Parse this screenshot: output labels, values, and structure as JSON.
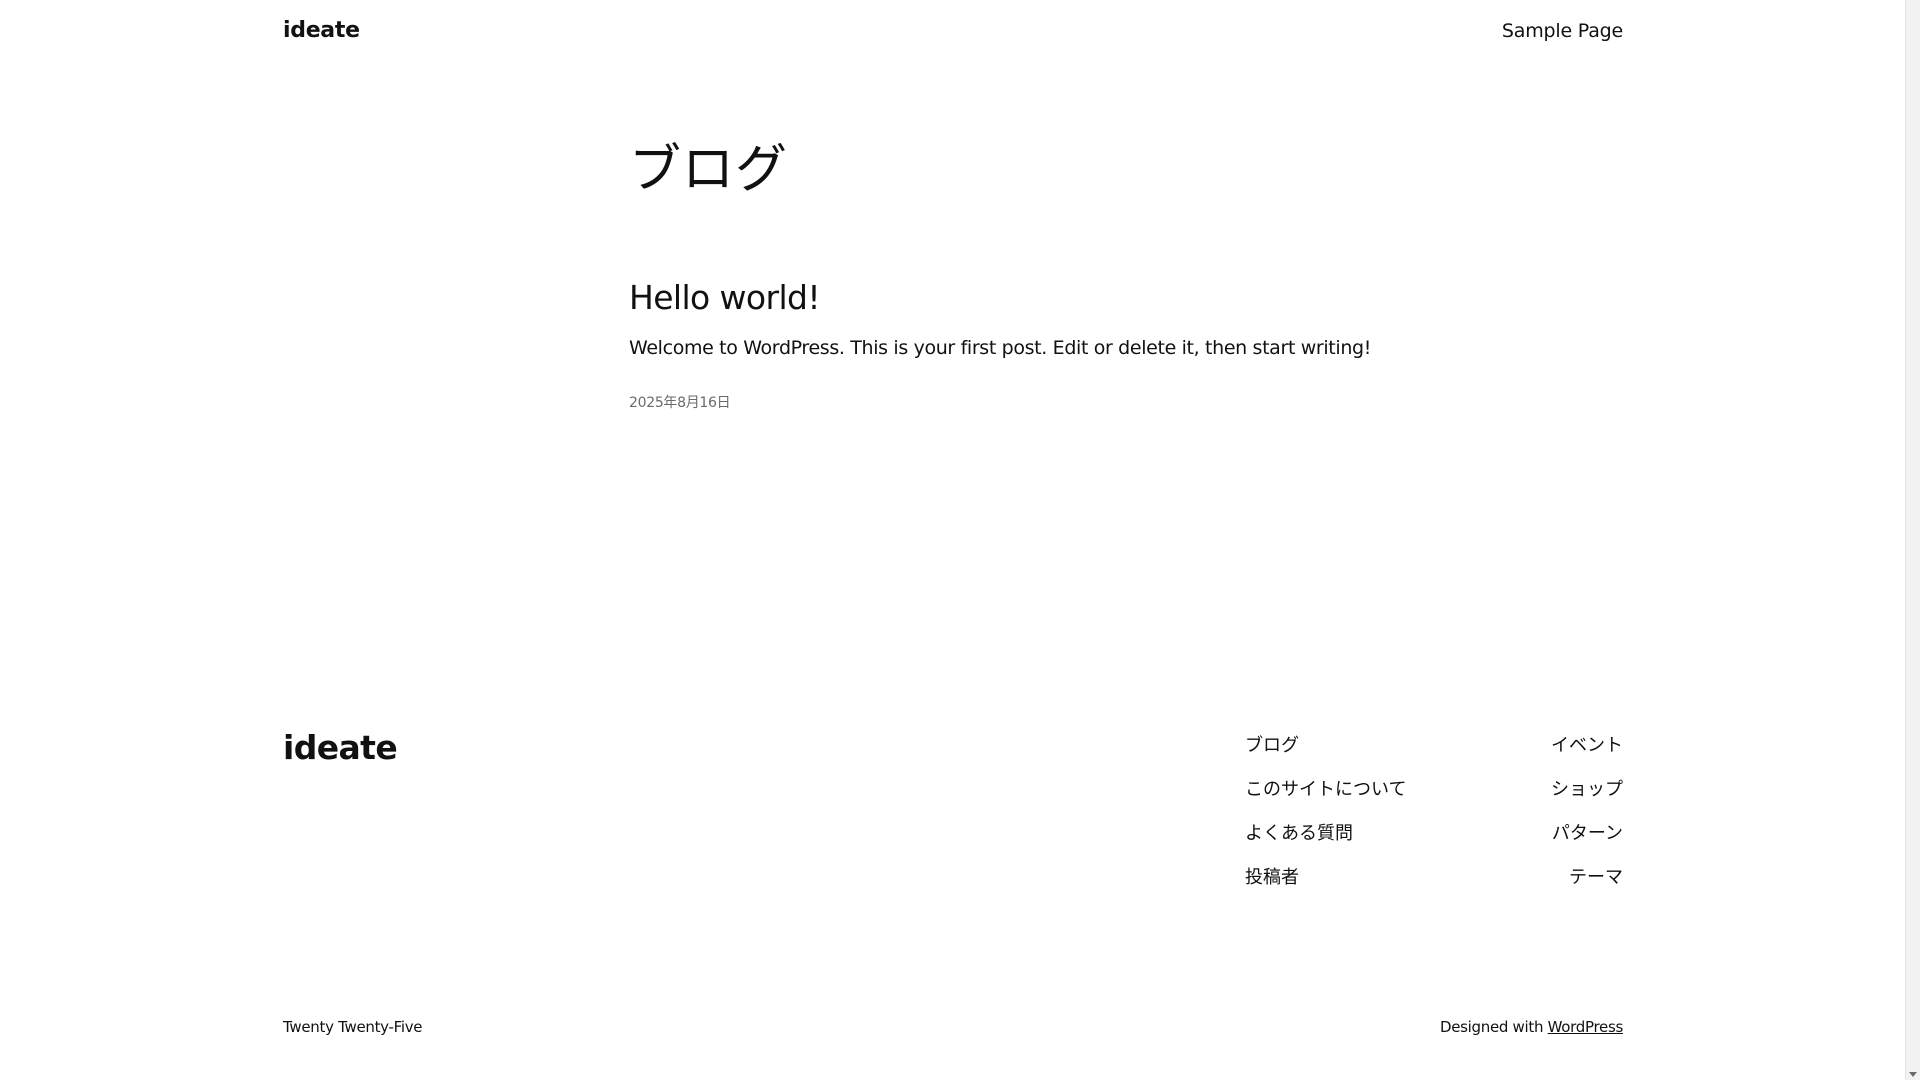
{
  "header": {
    "site_title": "ideate",
    "nav": [
      "Sample Page"
    ]
  },
  "main": {
    "heading": "ブログ",
    "post": {
      "title": "Hello world!",
      "excerpt": "Welcome to WordPress. This is your first post. Edit or delete it, then start writing!",
      "date": "2025年8月16日"
    }
  },
  "footer": {
    "site_title": "ideate",
    "col1": [
      "ブログ",
      "このサイトについて",
      "よくある質問",
      "投稿者"
    ],
    "col2": [
      "イベント",
      "ショップ",
      "パターン",
      "テーマ"
    ]
  },
  "bottom": {
    "theme_name": "Twenty Twenty-Five",
    "credit_prefix": "Designed with ",
    "credit_link": "WordPress"
  }
}
